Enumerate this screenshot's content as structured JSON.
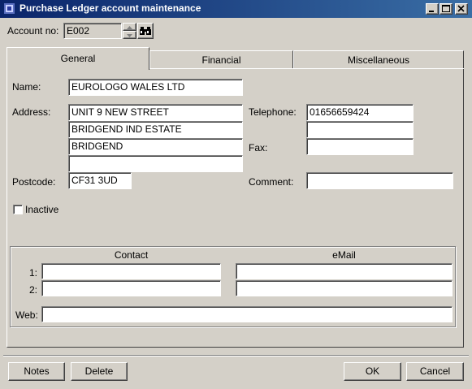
{
  "window": {
    "title": "Purchase Ledger account maintenance"
  },
  "account": {
    "label": "Account no:",
    "value": "E002"
  },
  "tabs": [
    {
      "label": "General",
      "active": true
    },
    {
      "label": "Financial",
      "active": false
    },
    {
      "label": "Miscellaneous",
      "active": false
    }
  ],
  "general": {
    "name_label": "Name:",
    "name": "EUROLOGO WALES LTD",
    "address_label": "Address:",
    "address": [
      "UNIT 9 NEW STREET",
      "BRIDGEND IND ESTATE",
      "BRIDGEND",
      ""
    ],
    "postcode_label": "Postcode:",
    "postcode": "CF31 3UD",
    "telephone_label": "Telephone:",
    "telephone": [
      "01656659424",
      ""
    ],
    "fax_label": "Fax:",
    "fax": "",
    "comment_label": "Comment:",
    "comment": "",
    "inactive_label": "Inactive",
    "inactive_checked": false
  },
  "contacts": {
    "contact_header": "Contact",
    "email_header": "eMail",
    "rows": [
      {
        "label": "1:",
        "contact": "",
        "email": ""
      },
      {
        "label": "2:",
        "contact": "",
        "email": ""
      }
    ],
    "web_label": "Web:",
    "web": ""
  },
  "buttons": {
    "notes": "Notes",
    "delete": "Delete",
    "ok": "OK",
    "cancel": "Cancel"
  },
  "colors": {
    "titlebar_start": "#0a246a",
    "titlebar_end": "#3a6ea5",
    "face": "#d4d0c8"
  },
  "icons": [
    "app-icon",
    "minimize-icon",
    "maximize-icon",
    "close-icon",
    "spin-up-icon",
    "spin-down-icon",
    "binoculars-icon"
  ]
}
